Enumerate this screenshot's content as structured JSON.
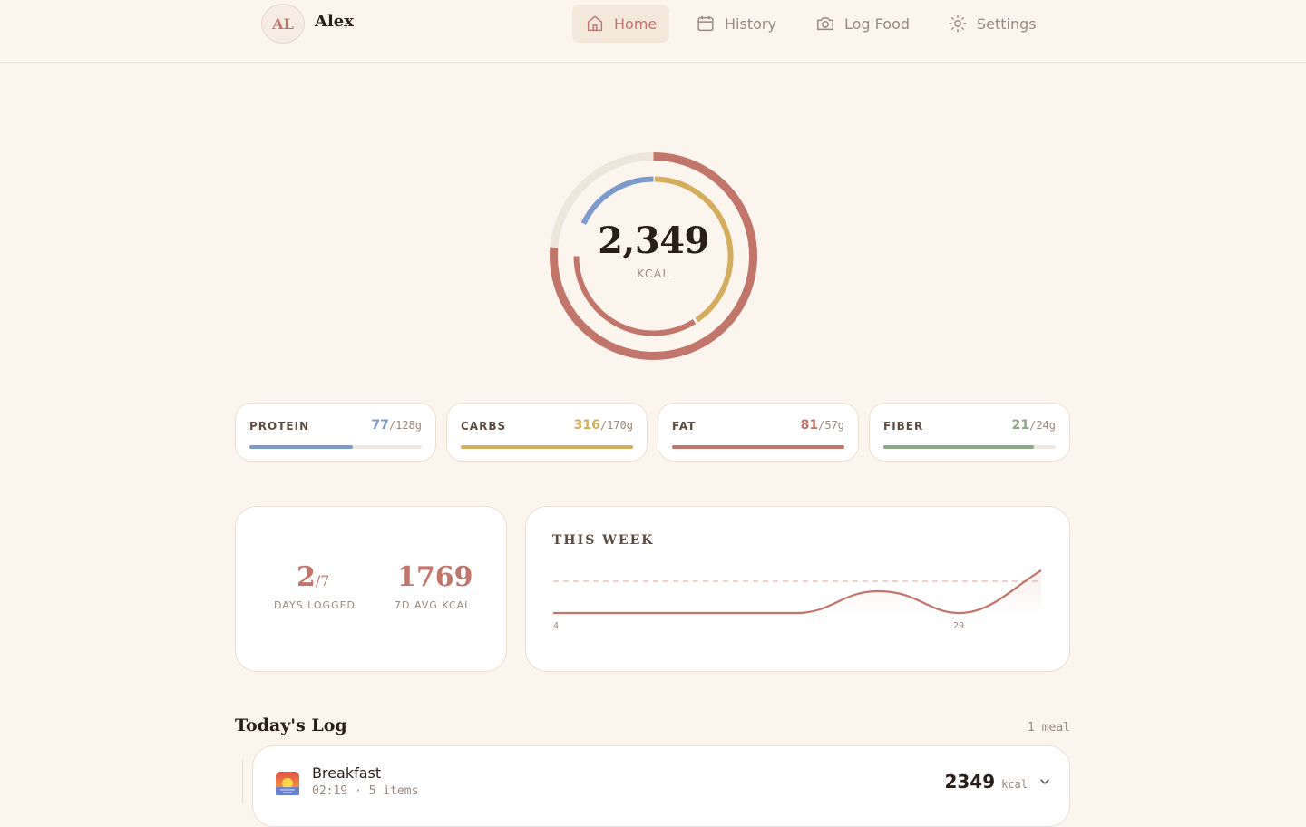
{
  "user": {
    "initials": "AL",
    "name": "Alex"
  },
  "nav": [
    {
      "label": "Home",
      "icon": "home-icon",
      "active": true
    },
    {
      "label": "History",
      "icon": "calendar-icon",
      "active": false
    },
    {
      "label": "Log Food",
      "icon": "camera-icon",
      "active": false
    },
    {
      "label": "Settings",
      "icon": "sun-icon",
      "active": false
    }
  ],
  "summary": {
    "kcal": "2,349",
    "unit": "KCAL"
  },
  "macros": [
    {
      "label": "PROTEIN",
      "value": "77",
      "goal": "/128g",
      "color": "#7c9bcb",
      "progress": 0.6
    },
    {
      "label": "CARBS",
      "value": "316",
      "goal": "/170g",
      "color": "#d4ad5f",
      "progress": 1.0
    },
    {
      "label": "FAT",
      "value": "81",
      "goal": "/57g",
      "color": "#c2766b",
      "progress": 1.0
    },
    {
      "label": "FIBER",
      "value": "21",
      "goal": "/24g",
      "color": "#8fa886",
      "progress": 0.875
    }
  ],
  "stats": {
    "days_logged": "2",
    "days_total": "/7",
    "days_label": "DAYS LOGGED",
    "avg_kcal": "1769",
    "avg_label": "7D AVG KCAL"
  },
  "week": {
    "title": "THIS WEEK",
    "tick_start": "4",
    "tick_mid": "29"
  },
  "log": {
    "title": "Today's Log",
    "count": "1 meal",
    "meals": [
      {
        "name": "Breakfast",
        "meta": "02:19 · 5 items",
        "kcal": "2349",
        "unit": "kcal",
        "icon": "sunrise-icon"
      }
    ]
  },
  "colors": {
    "accent": "#c2766b",
    "background": "#fcf5ee"
  }
}
